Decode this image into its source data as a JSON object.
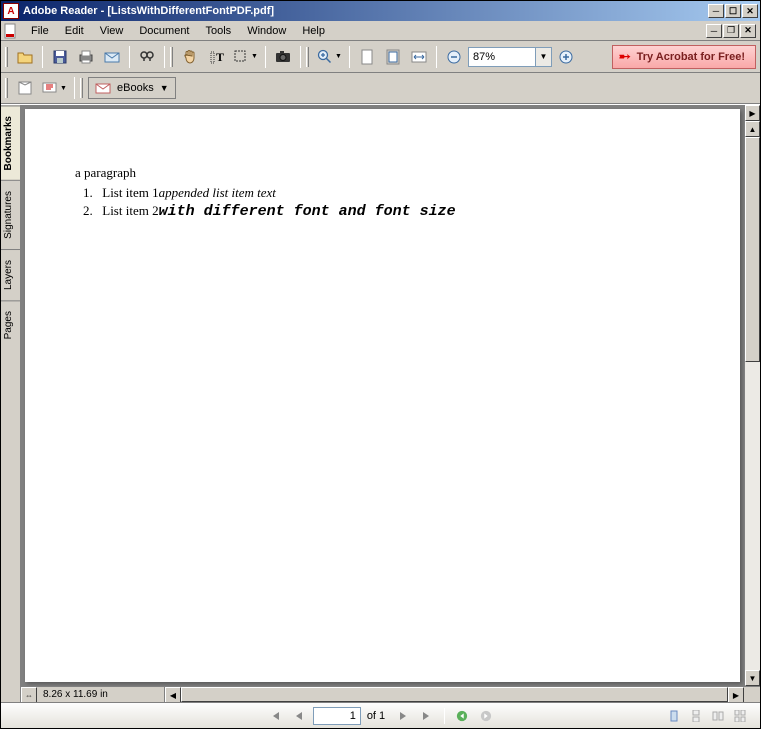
{
  "title": "Adobe Reader - [ListsWithDifferentFontPDF.pdf]",
  "menus": [
    "File",
    "Edit",
    "View",
    "Document",
    "Tools",
    "Window",
    "Help"
  ],
  "zoom": "87%",
  "try_label": "Try Acrobat for Free!",
  "ebooks_label": "eBooks",
  "side_tabs": [
    "Bookmarks",
    "Signatures",
    "Layers",
    "Pages"
  ],
  "document": {
    "paragraph": "a paragraph",
    "items": [
      {
        "num": "1.",
        "main": "List item 1",
        "append": "appended list item text"
      },
      {
        "num": "2.",
        "main": "List item 2",
        "append": "with different font and font size"
      }
    ]
  },
  "page_dim": "8.26 x 11.69 in",
  "page_current": "1",
  "page_total": "of 1"
}
